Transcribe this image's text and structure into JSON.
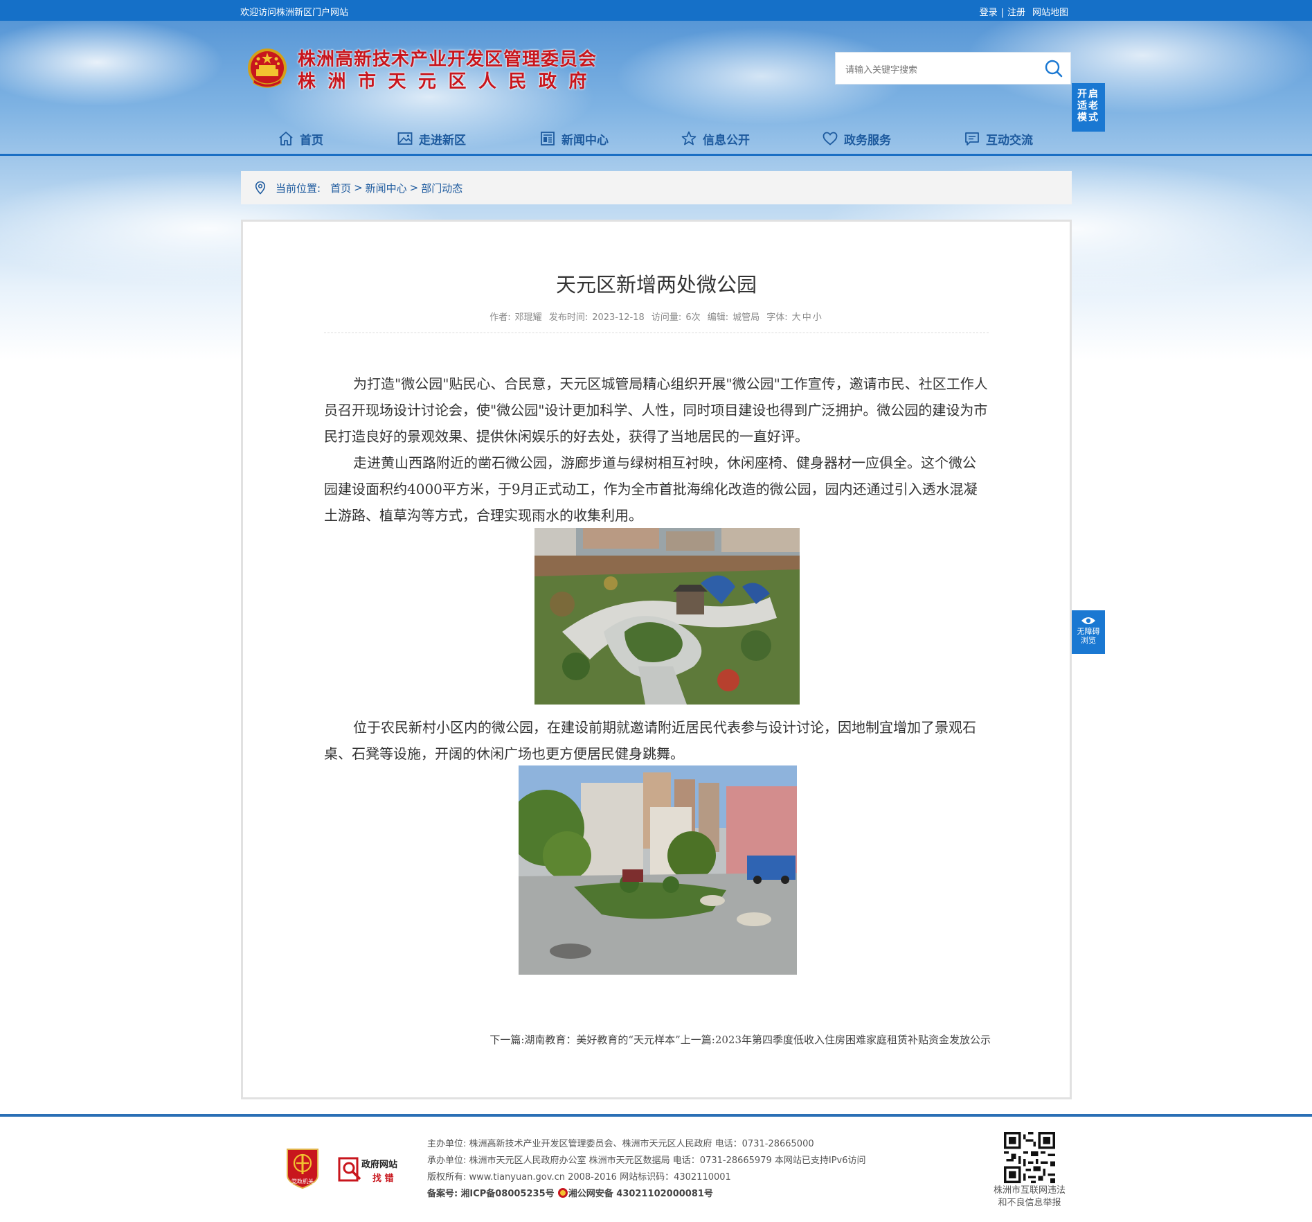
{
  "topbar": {
    "welcome": "欢迎访问株洲新区门户网站",
    "login": "登录",
    "separator": "|",
    "register": "注册",
    "sitemap": "网站地图"
  },
  "header": {
    "title_line1": "株洲高新技术产业开发区管理委员会",
    "title_line2": "株洲市天元区人民政府",
    "search_placeholder": "请输入关键字搜索",
    "elder_mode": [
      "开启",
      "适老",
      "模式"
    ]
  },
  "nav": {
    "items": [
      {
        "label": "首页",
        "icon": "home-icon"
      },
      {
        "label": "走进新区",
        "icon": "picture-icon"
      },
      {
        "label": "新闻中心",
        "icon": "newspaper-icon"
      },
      {
        "label": "信息公开",
        "icon": "star-icon"
      },
      {
        "label": "政务服务",
        "icon": "heart-icon"
      },
      {
        "label": "互动交流",
        "icon": "chat-icon"
      }
    ]
  },
  "breadcrumb": {
    "label": "当前位置:",
    "items": [
      "首页",
      "新闻中心",
      "部门动态"
    ],
    "separator": ">"
  },
  "article": {
    "title": "天元区新增两处微公园",
    "meta": {
      "author_label": "作者:",
      "author": "邓琨耀",
      "date_label": "发布时间:",
      "date": "2023-12-18",
      "views_label": "访问量:",
      "views": "6次",
      "editor_label": "编辑:",
      "editor": "城管局",
      "font_label": "字体:",
      "font_large": "大",
      "font_medium": "中",
      "font_small": "小"
    },
    "paragraphs": [
      "为打造\"微公园\"贴民心、合民意，天元区城管局精心组织开展\"微公园\"工作宣传，邀请市民、社区工作人员召开现场设计讨论会，使\"微公园\"设计更加科学、人性，同时项目建设也得到广泛拥护。微公园的建设为市民打造良好的景观效果、提供休闲娱乐的好去处，获得了当地居民的一直好评。",
      "走进黄山西路附近的凿石微公园，游廊步道与绿树相互衬映，休闲座椅、健身器材一应俱全。这个微公园建设面积约4000平方米，于9月正式动工，作为全市首批海绵化改造的微公园，园内还通过引入透水混凝土游路、植草沟等方式，合理实现雨水的收集利用。",
      "位于农民新村小区内的微公园，在建设前期就邀请附近居民代表参与设计讨论，因地制宜增加了景观石桌、石凳等设施，开阔的休闲广场也更方便居民健身跳舞。"
    ],
    "next_label": "下一篇:",
    "next": "湖南教育：美好教育的“天元样本”",
    "prev_label": "上一篇:",
    "prev": "2023年第四季度低收入住房困难家庭租赁补贴资金发放公示"
  },
  "a11y": {
    "line1": "无障碍",
    "line2": "浏览"
  },
  "footer": {
    "host_label": "主办单位:",
    "host": "株洲高新技术产业开发区管理委员会、株洲市天元区人民政府 电话：0731-28665000",
    "org_label": "承办单位:",
    "org": "株洲市天元区人民政府办公室 株洲市天元区数据局 电话：0731-28665979 本网站已支持IPv6访问",
    "copyright_label": "版权所有:",
    "copyright": "www.tianyuan.gov.cn 2008-2016 网站标识码：4302110001",
    "icp_label": "备案号:",
    "icp": "湘ICP备08005235号",
    "police": "湘公网安备 43021102000081号",
    "badge_party": "党政机关",
    "badge_error_1": "政府网站",
    "badge_error_2": "找 错",
    "qr_text_1": "株洲市互联网违法",
    "qr_text_2": "和不良信息举报"
  },
  "colors": {
    "primary": "#1570c8",
    "title_red": "#c8161d",
    "nav_text": "#1d5a9e"
  }
}
